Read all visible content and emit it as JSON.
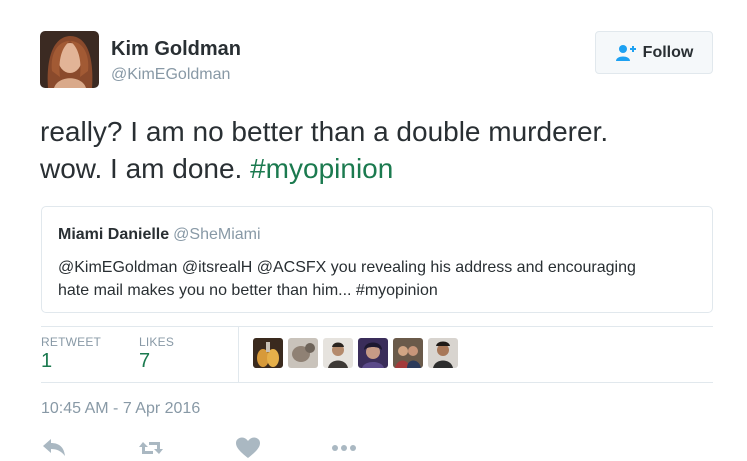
{
  "author": {
    "name": "Kim Goldman",
    "handle": "@KimEGoldman"
  },
  "follow": {
    "label": "Follow",
    "icon": "add-user-icon"
  },
  "tweet": {
    "line1": "really? I am no better than a double murderer.",
    "line2_text": "wow. I am done. ",
    "hashtag": "#myopinion"
  },
  "quoted": {
    "name": "Miami Danielle",
    "handle": "@SheMiami",
    "line1": "@KimEGoldman @itsrealH @ACSFX you revealing his address and encouraging",
    "line2": "hate mail makes you no better than him... #myopinion"
  },
  "stats": {
    "retweets_label": "RETWEET",
    "retweets_count": "1",
    "likes_label": "LIKES",
    "likes_count": "7"
  },
  "timestamp": "10:45 AM - 7 Apr 2016",
  "actions": [
    "reply-icon",
    "retweet-icon",
    "heart-icon",
    "more-icon"
  ],
  "colors": {
    "hashtag": "#1b7a4f",
    "muted": "#8899a6",
    "text": "#292f33",
    "border": "#e1e8ed"
  }
}
